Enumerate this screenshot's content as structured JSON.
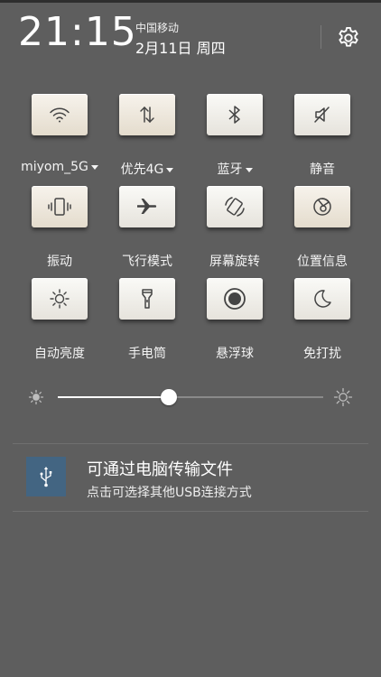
{
  "status": {
    "time": "21:15",
    "carrier": "中国移动",
    "date": "2月11日 周四"
  },
  "header": {
    "settings_icon": "gear-icon"
  },
  "toggles": [
    {
      "label": "miyom_5G",
      "icon": "wifi-icon",
      "dropdown": true
    },
    {
      "label": "优先4G",
      "icon": "mobile-data-icon",
      "dropdown": true
    },
    {
      "label": "蓝牙",
      "icon": "bluetooth-icon",
      "dropdown": true
    },
    {
      "label": "静音",
      "icon": "mute-icon",
      "dropdown": false
    },
    {
      "label": "振动",
      "icon": "vibrate-icon",
      "dropdown": false
    },
    {
      "label": "飞行模式",
      "icon": "airplane-icon",
      "dropdown": false
    },
    {
      "label": "屏幕旋转",
      "icon": "rotate-screen-icon",
      "dropdown": false
    },
    {
      "label": "位置信息",
      "icon": "location-icon",
      "dropdown": false
    },
    {
      "label": "自动亮度",
      "icon": "auto-brightness-icon",
      "dropdown": false
    },
    {
      "label": "手电筒",
      "icon": "flashlight-icon",
      "dropdown": false
    },
    {
      "label": "悬浮球",
      "icon": "floating-ball-icon",
      "dropdown": false
    },
    {
      "label": "免打扰",
      "icon": "do-not-disturb-icon",
      "dropdown": false
    }
  ],
  "brightness": {
    "level": 0.42,
    "min_icon": "brightness-low-icon",
    "max_icon": "brightness-high-icon"
  },
  "notification": {
    "icon": "usb-icon",
    "title": "可通过电脑传输文件",
    "text": "点击可选择其他USB连接方式",
    "icon_color": "#436582"
  }
}
